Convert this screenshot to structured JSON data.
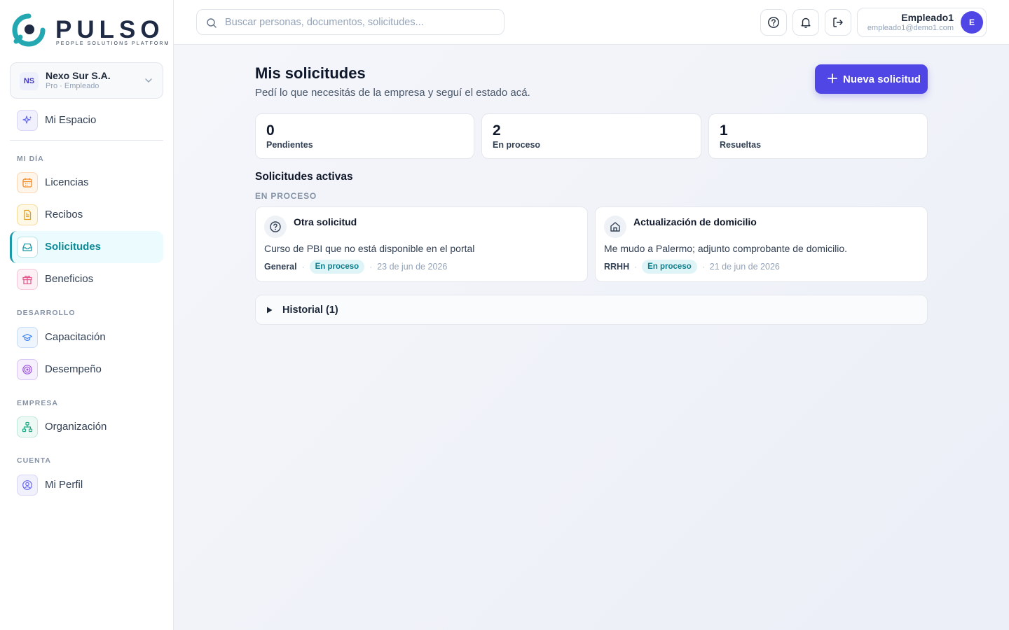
{
  "brand": {
    "name": "PULSO",
    "tagline": "PEOPLE SOLUTIONS PLATFORM",
    "colors": {
      "teal": "#23a8b2",
      "navy": "#1f2a44",
      "accent": "#4f46e5"
    }
  },
  "org": {
    "badge": "NS",
    "name": "Nexo Sur S.A.",
    "plan": "Pro · Empleado"
  },
  "nav": {
    "home": {
      "label": "Mi Espacio",
      "icon": "sparkles-icon"
    },
    "sections": {
      "mi_dia": "MI DÍA",
      "desarrollo": "DESARROLLO",
      "empresa": "EMPRESA",
      "cuenta": "CUENTA"
    },
    "items": {
      "licencias": {
        "label": "Licencias",
        "icon": "calendar-icon"
      },
      "recibos": {
        "label": "Recibos",
        "icon": "document-icon"
      },
      "solicitudes": {
        "label": "Solicitudes",
        "icon": "inbox-icon",
        "active": true
      },
      "beneficios": {
        "label": "Beneficios",
        "icon": "gift-icon"
      },
      "capacitacion": {
        "label": "Capacitación",
        "icon": "graduation-cap-icon"
      },
      "desempeno": {
        "label": "Desempeño",
        "icon": "target-icon"
      },
      "organizacion": {
        "label": "Organización",
        "icon": "org-chart-icon"
      },
      "perfil": {
        "label": "Mi Perfil",
        "icon": "user-circle-icon"
      }
    }
  },
  "header": {
    "search_placeholder": "Buscar personas, documentos, solicitudes...",
    "user": {
      "name": "Empleado1",
      "email": "empleado1@demo1.com",
      "initial": "E"
    }
  },
  "main": {
    "title": "Mis solicitudes",
    "subtitle": "Pedí lo que necesitás de la empresa y seguí el estado acá.",
    "new_button": "Nueva solicitud",
    "stats": [
      {
        "value": "0",
        "label": "Pendientes"
      },
      {
        "value": "2",
        "label": "En proceso"
      },
      {
        "value": "1",
        "label": "Resueltas"
      }
    ],
    "active_title": "Solicitudes activas",
    "group_label": "EN PROCESO",
    "cards": [
      {
        "title": "Otra solicitud",
        "description": "Curso de PBI que no está disponible en el portal",
        "category": "General",
        "status": "En proceso",
        "date": "23 de jun de 2026",
        "icon": "question-circle-icon"
      },
      {
        "title": "Actualización de domicilio",
        "description": "Me mudo a Palermo; adjunto comprobante de domicilio.",
        "category": "RRHH",
        "status": "En proceso",
        "date": "21 de jun de 2026",
        "icon": "home-icon"
      }
    ],
    "history_label": "Historial (1)"
  }
}
